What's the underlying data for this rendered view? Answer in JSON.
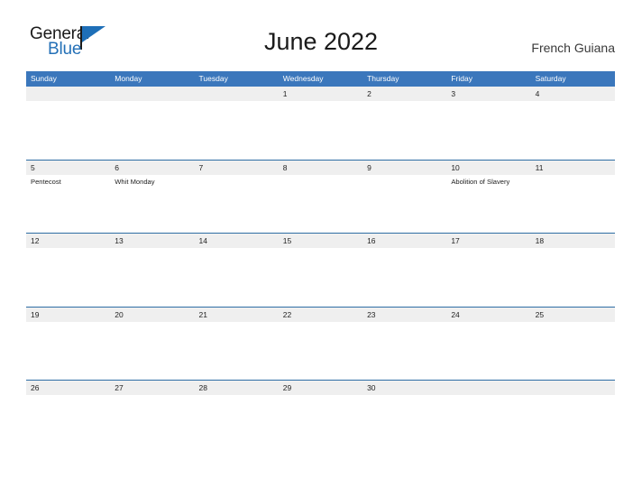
{
  "brand": {
    "name_part1": "General",
    "name_part2": "Blue",
    "primary_color": "#1e6fb8"
  },
  "header": {
    "title": "June 2022",
    "country": "French Guiana"
  },
  "calendar": {
    "header_color": "#3b77bc",
    "band_color": "#efefef",
    "rule_color": "#2e6da4",
    "weekdays": [
      "Sunday",
      "Monday",
      "Tuesday",
      "Wednesday",
      "Thursday",
      "Friday",
      "Saturday"
    ],
    "weeks": [
      [
        {
          "date": "",
          "event": ""
        },
        {
          "date": "",
          "event": ""
        },
        {
          "date": "",
          "event": ""
        },
        {
          "date": "1",
          "event": ""
        },
        {
          "date": "2",
          "event": ""
        },
        {
          "date": "3",
          "event": ""
        },
        {
          "date": "4",
          "event": ""
        }
      ],
      [
        {
          "date": "5",
          "event": "Pentecost"
        },
        {
          "date": "6",
          "event": "Whit Monday"
        },
        {
          "date": "7",
          "event": ""
        },
        {
          "date": "8",
          "event": ""
        },
        {
          "date": "9",
          "event": ""
        },
        {
          "date": "10",
          "event": "Abolition of Slavery"
        },
        {
          "date": "11",
          "event": ""
        }
      ],
      [
        {
          "date": "12",
          "event": ""
        },
        {
          "date": "13",
          "event": ""
        },
        {
          "date": "14",
          "event": ""
        },
        {
          "date": "15",
          "event": ""
        },
        {
          "date": "16",
          "event": ""
        },
        {
          "date": "17",
          "event": ""
        },
        {
          "date": "18",
          "event": ""
        }
      ],
      [
        {
          "date": "19",
          "event": ""
        },
        {
          "date": "20",
          "event": ""
        },
        {
          "date": "21",
          "event": ""
        },
        {
          "date": "22",
          "event": ""
        },
        {
          "date": "23",
          "event": ""
        },
        {
          "date": "24",
          "event": ""
        },
        {
          "date": "25",
          "event": ""
        }
      ],
      [
        {
          "date": "26",
          "event": ""
        },
        {
          "date": "27",
          "event": ""
        },
        {
          "date": "28",
          "event": ""
        },
        {
          "date": "29",
          "event": ""
        },
        {
          "date": "30",
          "event": ""
        },
        {
          "date": "",
          "event": ""
        },
        {
          "date": "",
          "event": ""
        }
      ]
    ]
  }
}
